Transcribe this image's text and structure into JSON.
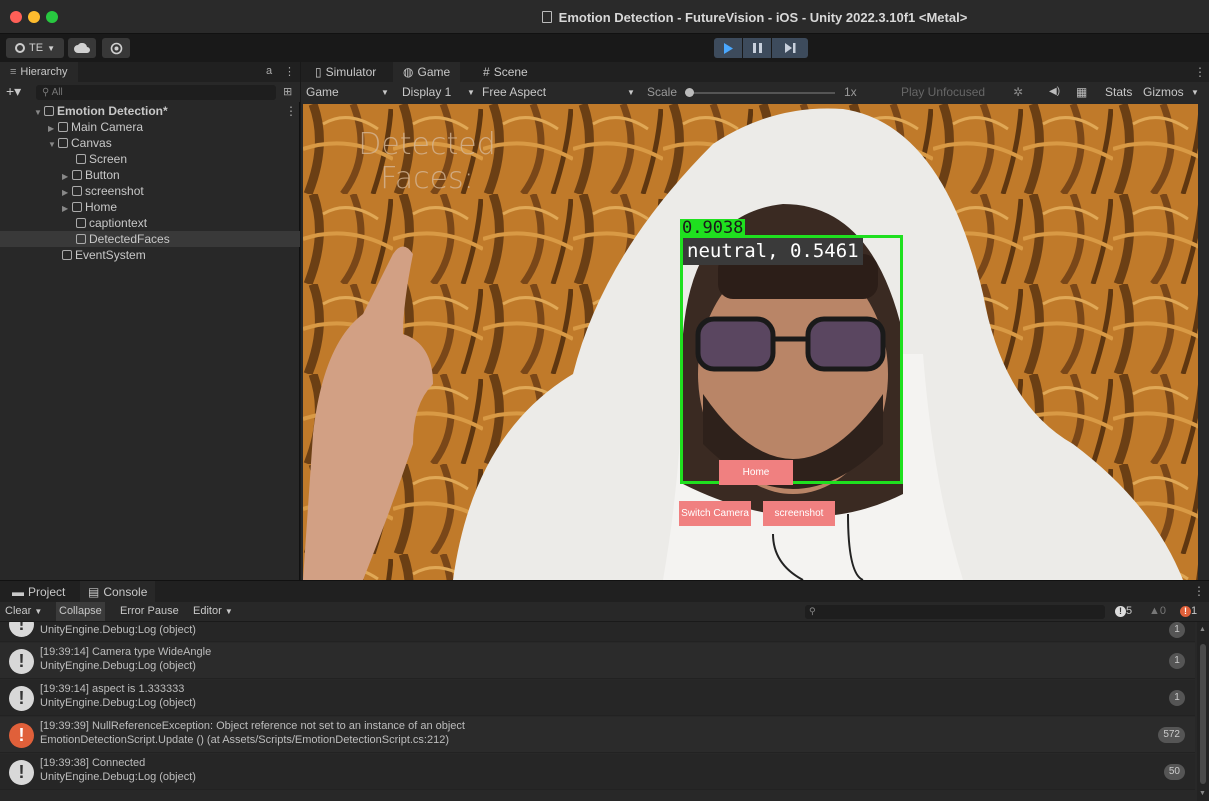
{
  "window": {
    "title": "Emotion Detection - FutureVision - iOS - Unity 2022.3.10f1 <Metal>",
    "traffic_colors": [
      "#fe5f57",
      "#febc2e",
      "#28c840"
    ]
  },
  "toolbar": {
    "account_label": "TE",
    "accent": "#3d4b5c"
  },
  "hierarchy": {
    "tab_label": "Hierarchy",
    "search_placeholder": "All",
    "items": [
      {
        "label": "Emotion Detection*"
      },
      {
        "label": "Main Camera"
      },
      {
        "label": "Canvas"
      },
      {
        "label": "Screen"
      },
      {
        "label": "Button"
      },
      {
        "label": "screenshot"
      },
      {
        "label": "Home"
      },
      {
        "label": "captiontext"
      },
      {
        "label": "DetectedFaces"
      },
      {
        "label": "EventSystem"
      }
    ]
  },
  "game": {
    "tabs": [
      {
        "label": "Simulator"
      },
      {
        "label": "Game"
      },
      {
        "label": "Scene"
      }
    ],
    "bar": {
      "mode": "Game",
      "display": "Display 1",
      "aspect": "Free Aspect",
      "scale_label": "Scale",
      "scale_value": "1x",
      "play_mode": "Play Unfocused",
      "stats": "Stats",
      "gizmos": "Gizmos"
    },
    "overlay": {
      "title_line1": "Detected",
      "title_line2": "Faces:",
      "face_score": "0.9038",
      "emotion_label": "neutral, 0.5461",
      "home_button": "Home",
      "switch_camera_button": "Switch Camera",
      "screenshot_button": "screenshot",
      "box_color": "#1fe01f",
      "button_color": "#f08080"
    }
  },
  "console": {
    "tabs": [
      {
        "label": "Project"
      },
      {
        "label": "Console"
      }
    ],
    "bar": {
      "clear": "Clear",
      "collapse": "Collapse",
      "error_pause": "Error Pause",
      "editor": "Editor",
      "info_count": "5",
      "warn_count": "0",
      "error_count": "1"
    },
    "logs": [
      {
        "line1": "UnityEngine.Debug:Log (object)",
        "line2": "",
        "count": "1",
        "type": "info"
      },
      {
        "line1": "[19:39:14] Camera type WideAngle",
        "line2": "UnityEngine.Debug:Log (object)",
        "count": "1",
        "type": "info"
      },
      {
        "line1": "[19:39:14] aspect is 1.333333",
        "line2": "UnityEngine.Debug:Log (object)",
        "count": "1",
        "type": "info"
      },
      {
        "line1": "[19:39:39] NullReferenceException: Object reference not set to an instance of an object",
        "line2": "EmotionDetectionScript.Update () (at Assets/Scripts/EmotionDetectionScript.cs:212)",
        "count": "572",
        "type": "error"
      },
      {
        "line1": "[19:39:38] Connected",
        "line2": "UnityEngine.Debug:Log (object)",
        "count": "50",
        "type": "info"
      }
    ]
  }
}
